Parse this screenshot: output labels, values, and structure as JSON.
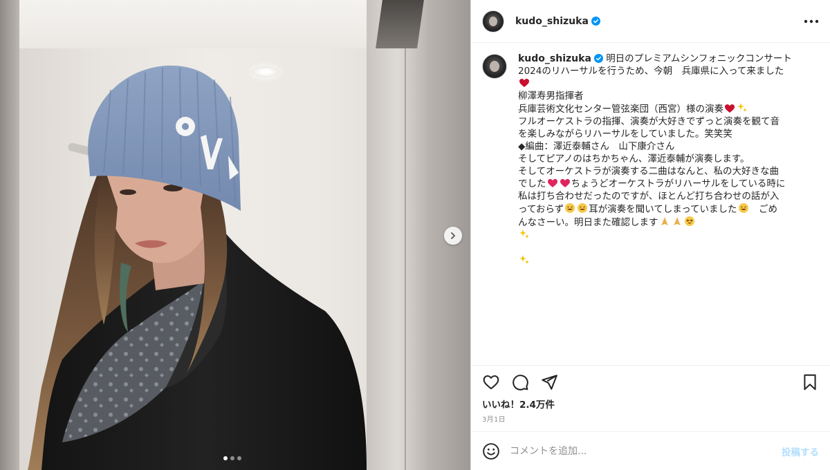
{
  "post": {
    "username": "kudo_shizuka",
    "verified": true,
    "caption_lines": [
      "明日のプレミアムシンフォニックコンサート",
      "2024のリハーサルを行うため、今朝　兵庫県に入って来ました",
      "",
      "",
      "柳澤寿男指揮者",
      "",
      "兵庫芸術文化センター管弦楽団（西宮）様の演奏",
      "",
      "フルオーケストラの指揮、演奏が大好きでずっと演奏を観て音",
      "を楽しみながらリハーサルをしていました。笑笑笑",
      "",
      "◆編曲：澤近泰輔さん　山下康介さん",
      "そしてピアノのはちかちゃん、澤近泰輔が演奏します。",
      "",
      "そしてオーケストラが演奏する二曲はなんと、私の大好きな曲",
      "でした",
      "ちょうどオーケストラがリハーサルをしている時に",
      "私は打ち合わせだったのですが、ほとんど打ち合わせの話が入",
      "っておらず",
      "耳が演奏を聞いてしまっていました",
      "　ごめ",
      "んなさーい。明日また確認します"
    ],
    "likes_text": "いいね！2.4万件",
    "date_text": "3月1日"
  },
  "icons": {
    "verified": "verified-badge-icon",
    "more": "more-options-icon",
    "like": "heart-icon",
    "comment": "comment-icon",
    "share": "share-icon",
    "save": "bookmark-icon",
    "emoji": "emoji-smile-icon",
    "next": "chevron-right-icon"
  },
  "comment": {
    "placeholder": "コメントを追加...",
    "post_label": "投稿する"
  },
  "carousel": {
    "count": 3,
    "active": 0
  },
  "colors": {
    "verified": "#0095f6",
    "post_disabled": "#b2dffc",
    "heart_red": "#e0245e"
  }
}
